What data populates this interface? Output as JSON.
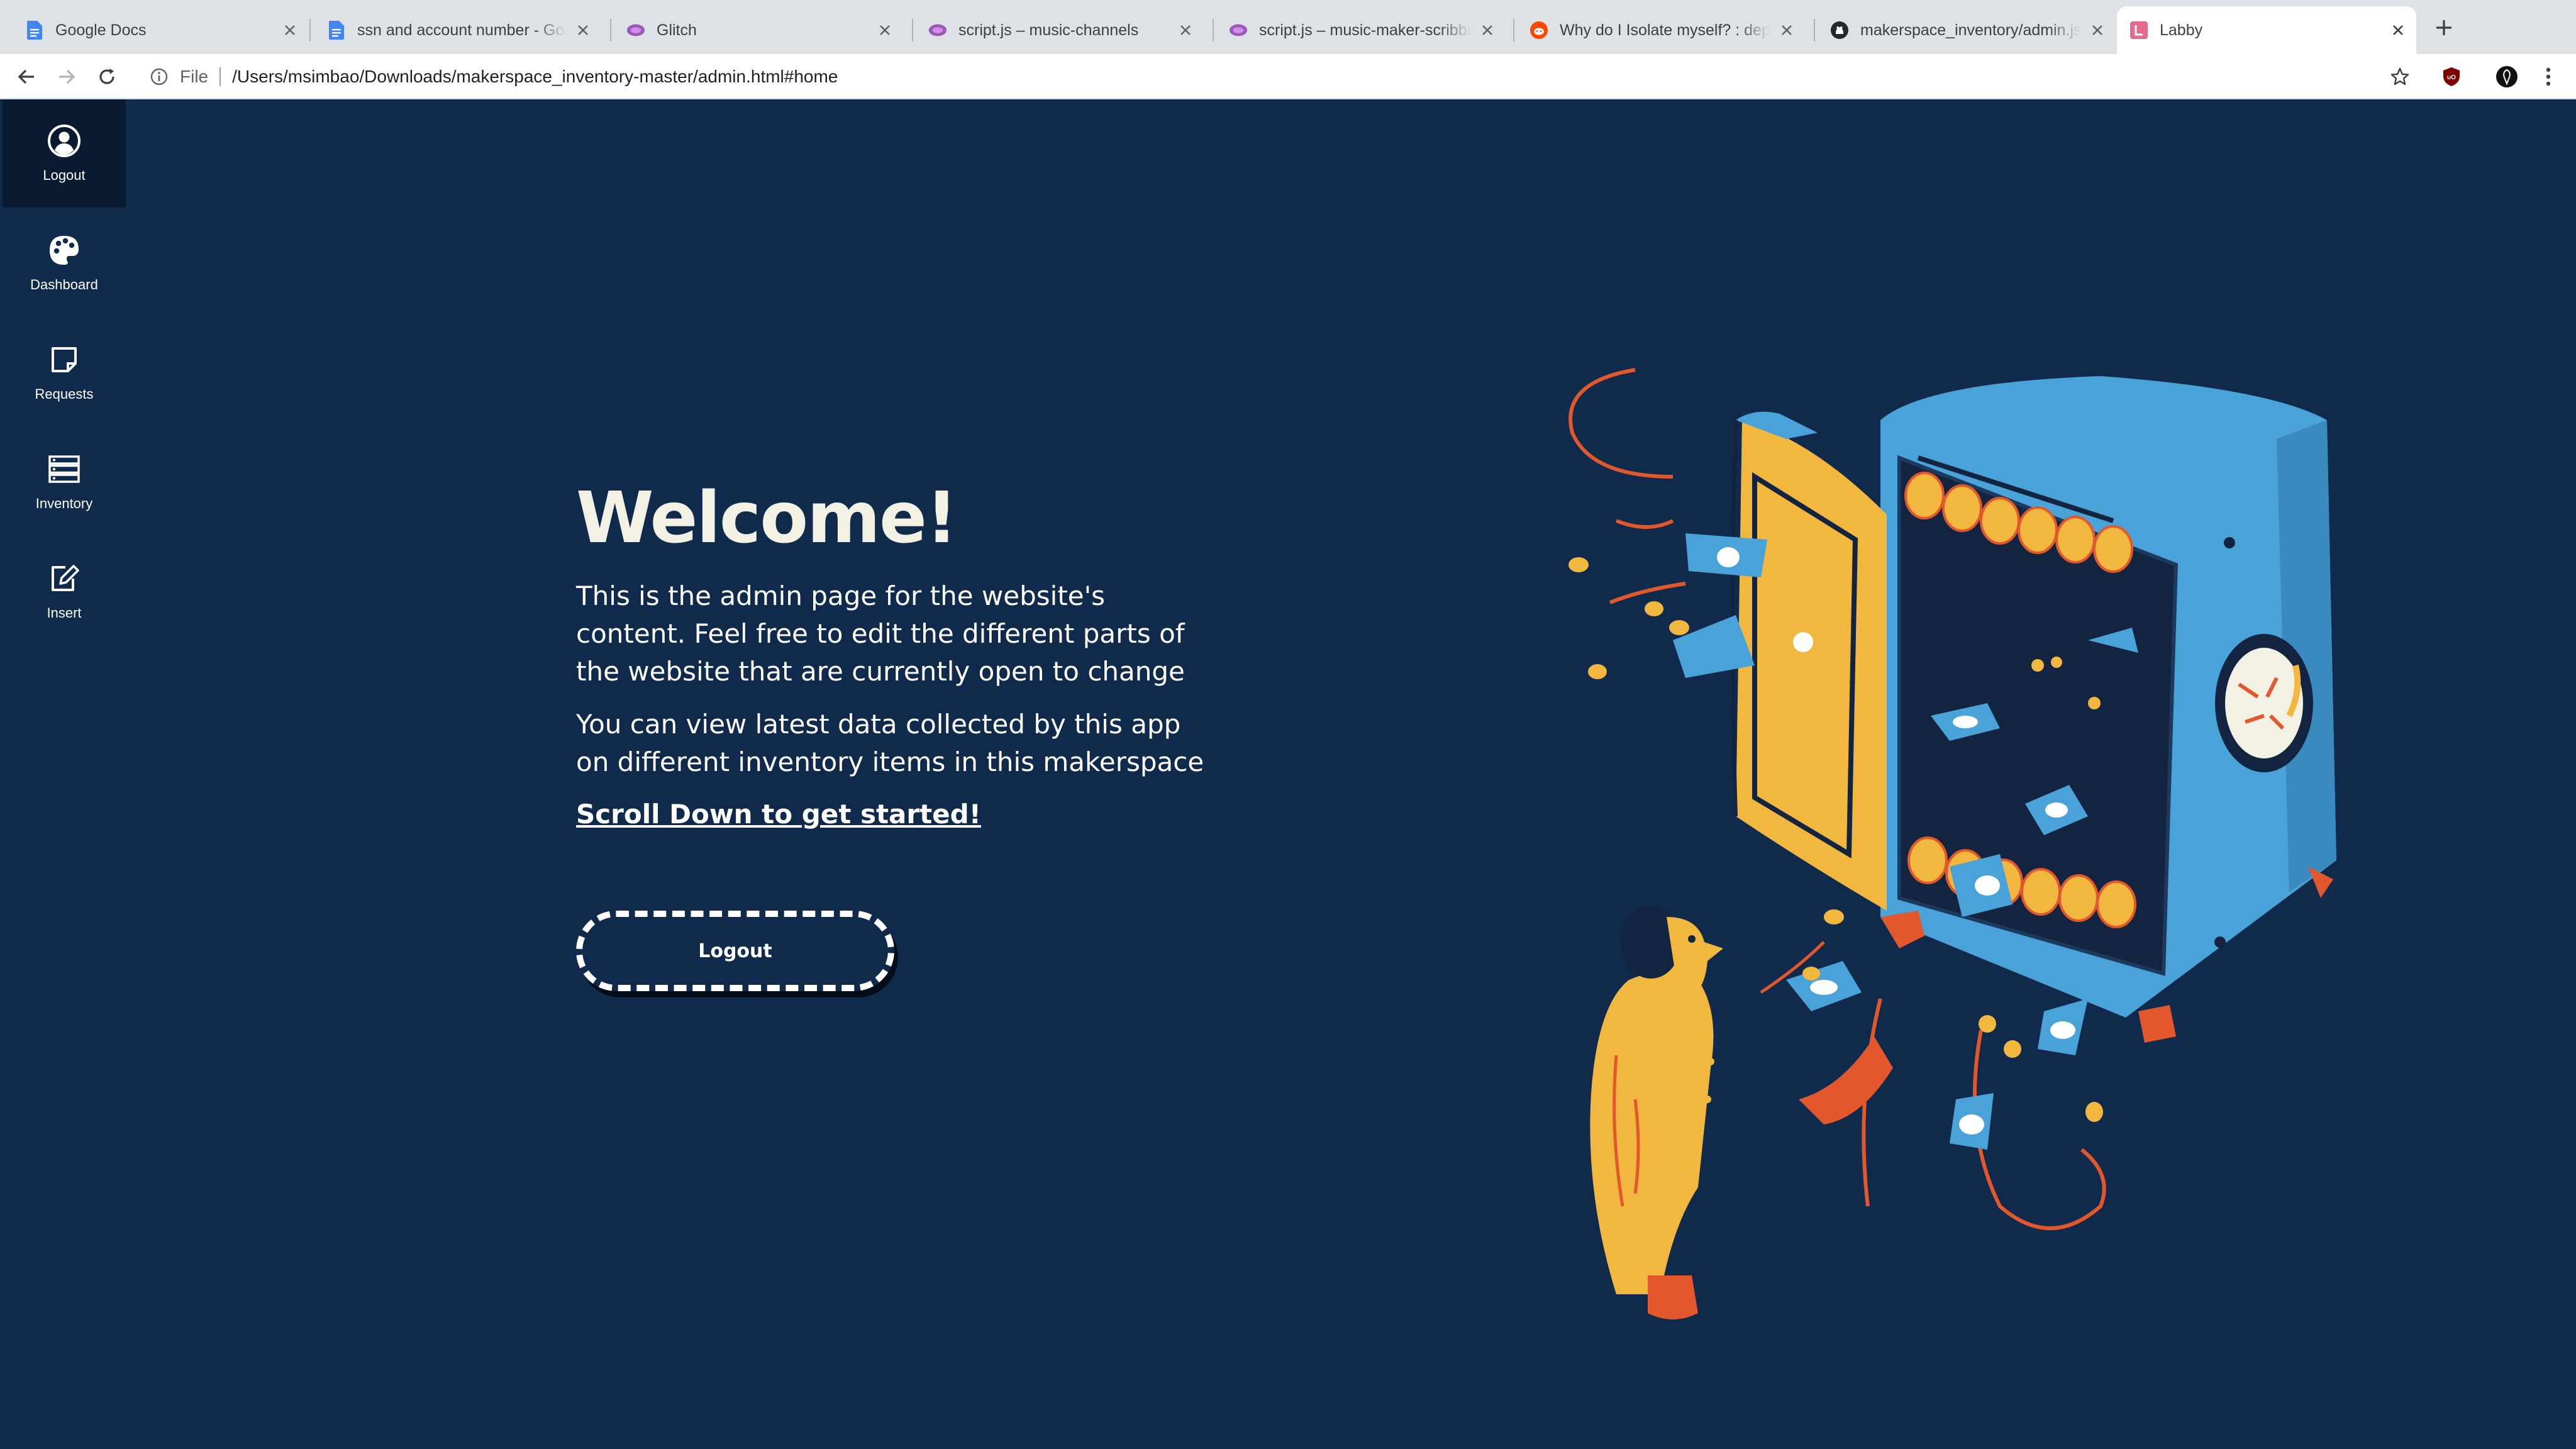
{
  "browser": {
    "tabs": [
      {
        "title": "Google Docs",
        "icon": "google-docs-icon",
        "active": false
      },
      {
        "title": "ssn and account number - Google Docs",
        "icon": "google-docs-icon",
        "active": false
      },
      {
        "title": "Glitch",
        "icon": "glitch-icon",
        "active": false
      },
      {
        "title": "script.js – music-channels",
        "icon": "glitch-icon",
        "active": false
      },
      {
        "title": "script.js – music-maker-scribble",
        "icon": "glitch-icon",
        "active": false
      },
      {
        "title": "Why do I Isolate myself? : depression",
        "icon": "reddit-icon",
        "active": false
      },
      {
        "title": "makerspace_inventory/admin.js",
        "icon": "github-icon",
        "active": false
      },
      {
        "title": "Labby",
        "icon": "labby-icon",
        "active": true
      }
    ],
    "address": {
      "scheme": "File",
      "url": "/Users/msimbao/Downloads/makerspace_inventory-master/admin.html#home"
    }
  },
  "sidebar": {
    "items": [
      {
        "label": "Logout",
        "icon": "user-circle-icon",
        "active": true
      },
      {
        "label": "Dashboard",
        "icon": "palette-icon",
        "active": false
      },
      {
        "label": "Requests",
        "icon": "sticky-note-icon",
        "active": false
      },
      {
        "label": "Inventory",
        "icon": "server-icon",
        "active": false
      },
      {
        "label": "Insert",
        "icon": "edit-icon",
        "active": false
      }
    ]
  },
  "hero": {
    "title": "Welcome!",
    "paragraph1": "This is the admin page for the website's content. Feel free to edit the different parts of the website that are currently open to change",
    "paragraph2": "You can view latest data collected by this app on different inventory items in this makerspace",
    "scroll_link": "Scroll Down to get started!",
    "logout_button": "Logout"
  },
  "colors": {
    "background": "#102a4c",
    "sidebar_active": "#0a1a30",
    "title": "#f3f1e3",
    "illustration_blue": "#4aa3d8",
    "illustration_yellow": "#f2b73f",
    "illustration_orange": "#e2572c"
  }
}
